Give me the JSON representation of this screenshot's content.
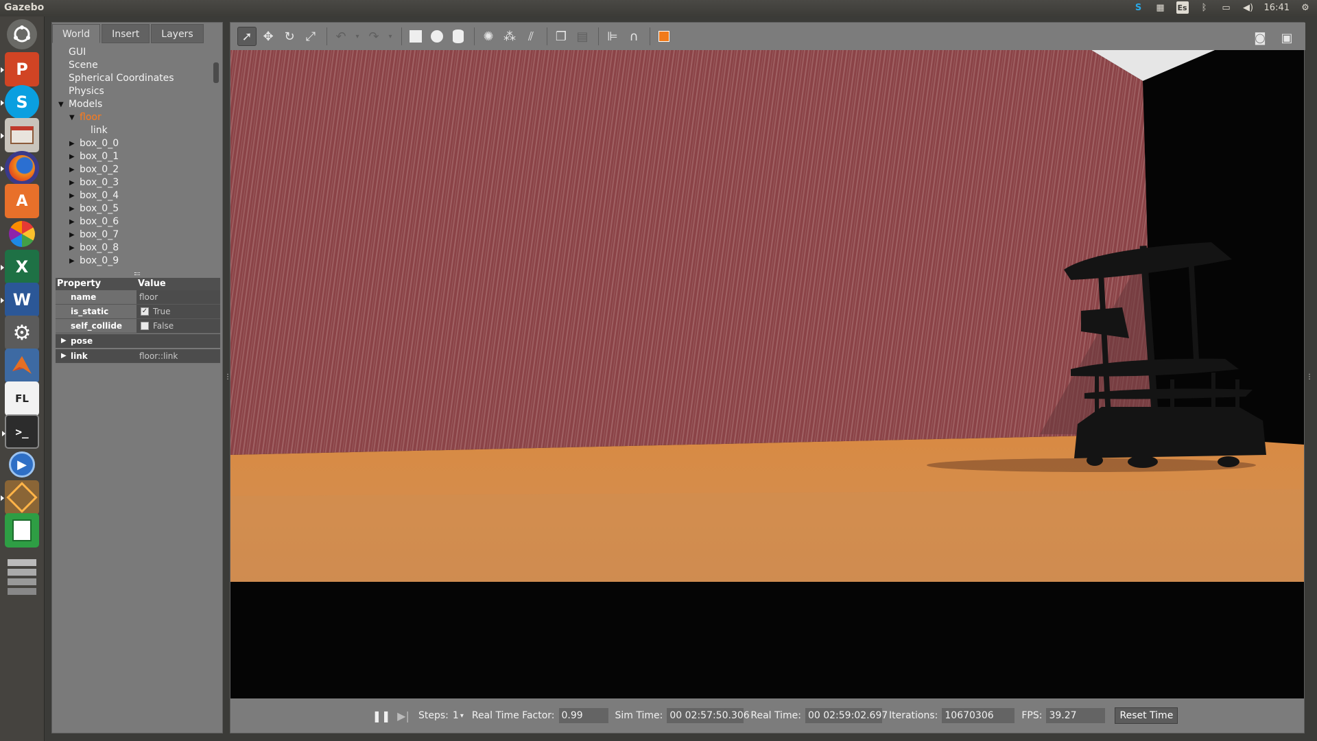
{
  "topbar": {
    "app_title": "Gazebo",
    "keyboard_layout": "Es",
    "clock": "16:41",
    "icons": [
      "skype-status-icon",
      "workspaces-icon",
      "keyboard-layout-icon",
      "bluetooth-icon",
      "battery-icon",
      "volume-icon",
      "settings-gear-icon"
    ]
  },
  "launcher": {
    "items": [
      "dash-home",
      "powerpoint",
      "skype",
      "file-manager",
      "firefox",
      "software-center",
      "picasa",
      "excel",
      "word",
      "system-settings",
      "matlab",
      "fl-studio",
      "terminal",
      "media-player",
      "virtualbox",
      "libreoffice-calc",
      "workspace-stack"
    ],
    "labels": {
      "powerpoint": "P",
      "skype": "S",
      "excel": "X",
      "word": "W",
      "fl": "FL"
    }
  },
  "tabs": [
    "World",
    "Insert",
    "Layers"
  ],
  "tree": {
    "items": [
      {
        "label": "GUI",
        "level": 1,
        "arrow": ""
      },
      {
        "label": "Scene",
        "level": 1,
        "arrow": ""
      },
      {
        "label": "Spherical Coordinates",
        "level": 1,
        "arrow": ""
      },
      {
        "label": "Physics",
        "level": 1,
        "arrow": ""
      },
      {
        "label": "Models",
        "level": 1,
        "arrow": "down"
      },
      {
        "label": "floor",
        "level": 2,
        "arrow": "down",
        "selected": true
      },
      {
        "label": "link",
        "level": 3,
        "arrow": ""
      },
      {
        "label": "box_0_0",
        "level": 2,
        "arrow": "right"
      },
      {
        "label": "box_0_1",
        "level": 2,
        "arrow": "right"
      },
      {
        "label": "box_0_2",
        "level": 2,
        "arrow": "right"
      },
      {
        "label": "box_0_3",
        "level": 2,
        "arrow": "right"
      },
      {
        "label": "box_0_4",
        "level": 2,
        "arrow": "right"
      },
      {
        "label": "box_0_5",
        "level": 2,
        "arrow": "right"
      },
      {
        "label": "box_0_6",
        "level": 2,
        "arrow": "right"
      },
      {
        "label": "box_0_7",
        "level": 2,
        "arrow": "right"
      },
      {
        "label": "box_0_8",
        "level": 2,
        "arrow": "right"
      },
      {
        "label": "box_0_9",
        "level": 2,
        "arrow": "right"
      }
    ]
  },
  "properties": {
    "header": {
      "property": "Property",
      "value": "Value"
    },
    "name": {
      "key": "name",
      "value": "floor"
    },
    "is_static": {
      "key": "is_static",
      "value": "True",
      "checked": true
    },
    "self_collide": {
      "key": "self_collide",
      "value": "False",
      "checked": false
    },
    "pose": {
      "key": "pose",
      "value": ""
    },
    "link": {
      "key": "link",
      "value": "floor::link"
    }
  },
  "toolbar": {
    "tools": [
      "select-mode",
      "translate-mode",
      "rotate-mode",
      "scale-mode",
      "undo",
      "redo",
      "box-shape",
      "sphere-shape",
      "cylinder-shape",
      "point-light",
      "spot-light",
      "directional-light",
      "copy",
      "paste",
      "align",
      "snap",
      "view-angle"
    ],
    "active": "select-mode",
    "right": [
      "screenshot",
      "record-log"
    ]
  },
  "bottombar": {
    "steps_label": "Steps:",
    "steps_value": "1",
    "rtf_label": "Real Time Factor:",
    "rtf_value": "0.99",
    "sim_time_label": "Sim Time:",
    "sim_time_value": "00 02:57:50.306",
    "real_time_label": "Real Time:",
    "real_time_value": "00 02:59:02.697",
    "iterations_label": "Iterations:",
    "iterations_value": "10670306",
    "fps_label": "FPS:",
    "fps_value": "39.27",
    "reset_label": "Reset Time"
  },
  "colors": {
    "selected_tree_item": "#ff7a1a",
    "floor": "#d8904c",
    "wall": "#8a3f42",
    "robot": "#141414"
  }
}
